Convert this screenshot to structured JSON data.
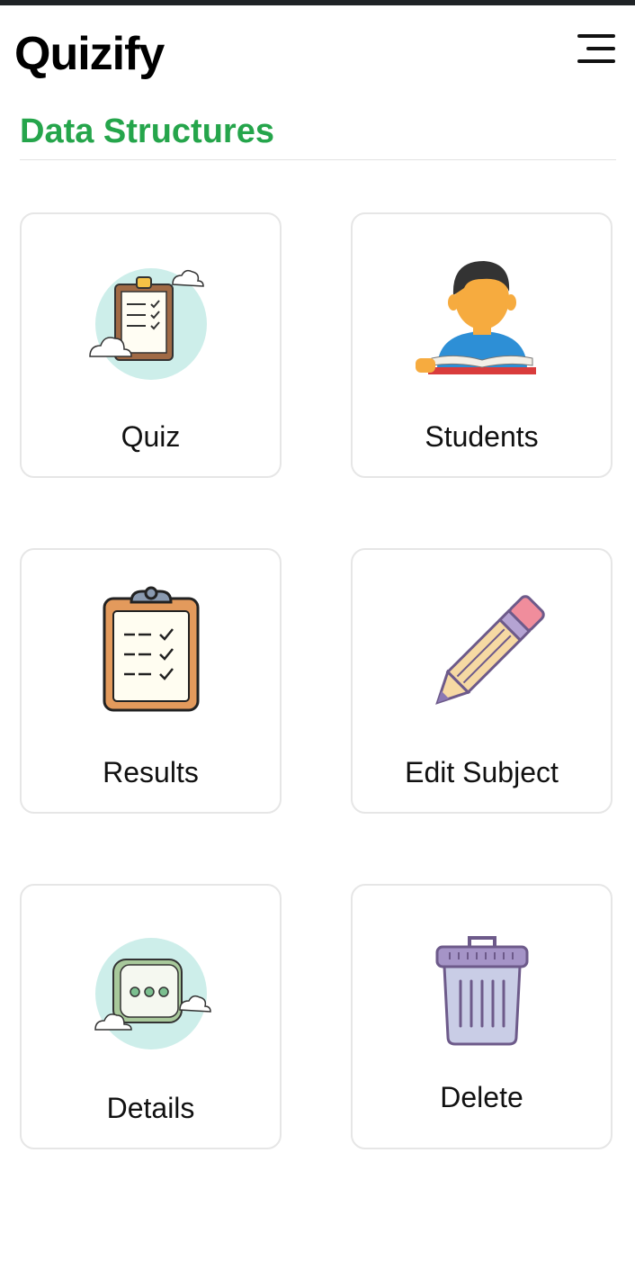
{
  "header": {
    "app_title": "Quizify",
    "menu_icon": "hamburger-menu-icon"
  },
  "section": {
    "title": "Data Structures"
  },
  "colors": {
    "accent": "#25a54b",
    "card_border": "#e6e6e6",
    "text": "#111111"
  },
  "cards": [
    {
      "label": "Quiz",
      "icon": "quiz-clipboard-icon"
    },
    {
      "label": "Students",
      "icon": "student-reading-icon"
    },
    {
      "label": "Results",
      "icon": "results-clipboard-icon"
    },
    {
      "label": "Edit Subject",
      "icon": "pencil-icon"
    },
    {
      "label": "Details",
      "icon": "chat-bubble-icon"
    },
    {
      "label": "Delete",
      "icon": "trash-can-icon"
    }
  ]
}
